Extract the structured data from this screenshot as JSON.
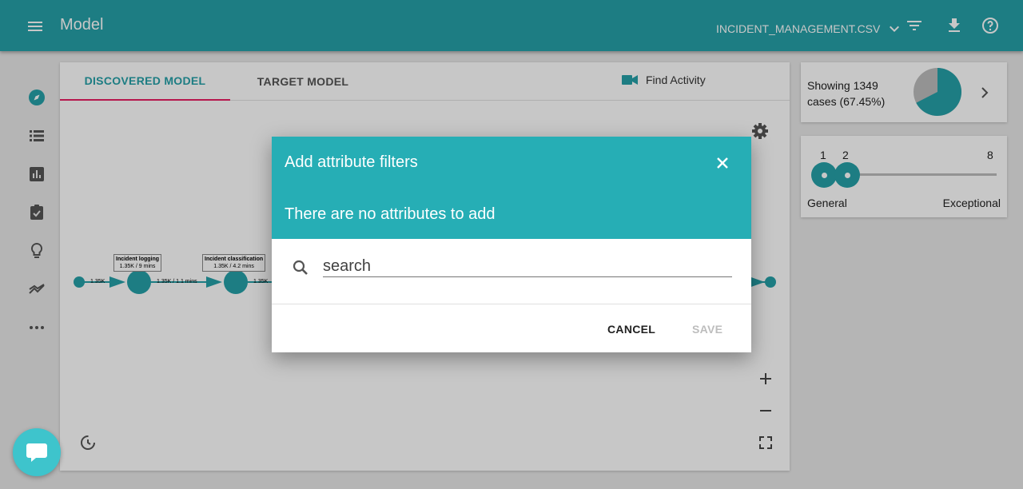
{
  "appbar": {
    "title": "Model",
    "dataset": "INCIDENT_MANAGEMENT.CSV",
    "icons": [
      "menu-icon",
      "chevron-down-icon",
      "filter-icon",
      "download-icon",
      "help-icon"
    ]
  },
  "rail": {
    "icons": [
      "compass-icon",
      "list-icon",
      "bar-chart-icon",
      "clipboard-check-icon",
      "lightbulb-icon",
      "trending-icon",
      "more-horizontal-icon"
    ]
  },
  "tabs": {
    "discovered": "DISCOVERED MODEL",
    "target": "TARGET MODEL",
    "find_activity": "Find Activity"
  },
  "model": {
    "nodes": [
      {
        "name": "Incident logging",
        "stats": "1.35K / 9 mins"
      },
      {
        "name": "Incident classification",
        "stats": "1.35K / 4.2 mins"
      }
    ],
    "edges": [
      "1.35K",
      "1.35K / 1.1 mins",
      "1.35K"
    ]
  },
  "cases": {
    "text": "Showing 1349 cases (67.45%)",
    "fraction": 0.6745
  },
  "slider": {
    "low": "1",
    "high": "2",
    "max": "8",
    "left_label": "General",
    "right_label": "Exceptional"
  },
  "dialog": {
    "title": "Add attribute filters",
    "subtitle": "There are no attributes to add",
    "search_placeholder": "search",
    "search_value": "",
    "cancel_label": "CANCEL",
    "save_label": "SAVE"
  },
  "colors": {
    "primary": "#26a0a8",
    "dialog_header": "#26aeb5",
    "tab_indicator": "#e91e63"
  }
}
